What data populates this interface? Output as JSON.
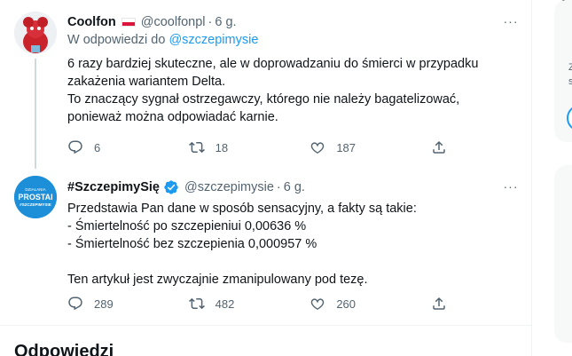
{
  "tweets": [
    {
      "name": "Coolfon",
      "flag": "polish-flag",
      "handle": "@coolfonpl",
      "time": "6 g.",
      "replying_prefix": "W odpowiedzi do",
      "replying_to": "@szczepimysie",
      "body": [
        "6 razy bardziej skuteczne, ale w doprowadzaniu do śmierci w przypadku",
        "zakażenia wariantem Delta.",
        "To znaczący sygnał ostrzegawczy, którego nie należy bagatelizować,",
        "ponieważ można odpowiadać karnie."
      ],
      "counts": {
        "replies": "6",
        "retweets": "18",
        "likes": "187"
      }
    },
    {
      "name": "#SzczepimySię",
      "verified": true,
      "handle": "@szczepimysie",
      "time": "6 g.",
      "avatar_text": [
        "DZIAŁANIA",
        "PROSTAI",
        "#SZCZEPIMYSIE"
      ],
      "body": [
        "Przedstawia Pan dane w sposób sensacyjny, a fakty są takie:",
        "- Śmiertelność po szczepieniui 0,00636 %",
        "- Śmiertelność bez szczepienia 0,000957 %",
        "",
        "Ten artykuł jest zwyczajnie zmanipulowany pod tezę."
      ],
      "counts": {
        "replies": "289",
        "retweets": "482",
        "likes": "260"
      }
    }
  ],
  "more_label": "···",
  "replies_header": "Odpowiedzi",
  "right_panel": {
    "line1": "Z",
    "line2": "s"
  },
  "colors": {
    "accent": "#1d9bf0",
    "muted": "#536471",
    "text": "#0f1419",
    "border": "#eff3f4"
  },
  "icons": [
    "reply-icon",
    "retweet-icon",
    "like-icon",
    "share-icon",
    "verified-icon",
    "more-icon"
  ]
}
